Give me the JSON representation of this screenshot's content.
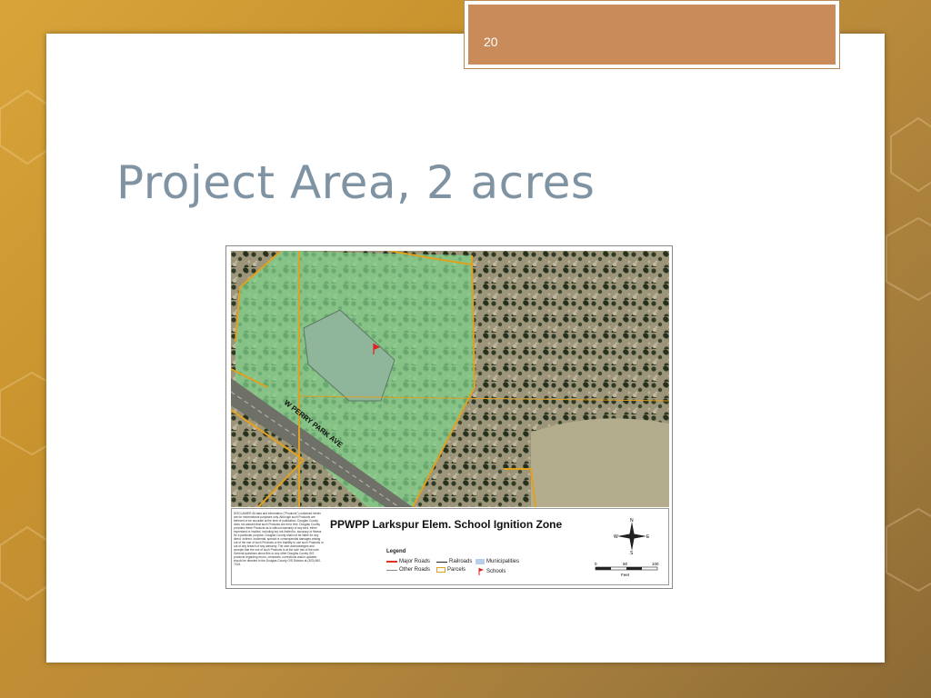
{
  "slide": {
    "number": "20",
    "title": "Project Area, 2 acres"
  },
  "map": {
    "road_label": "W PERRY PARK AVE",
    "title": "PPWPP Larkspur Elem. School Ignition Zone",
    "disclaimer": "DISCLAIMER All data and information (\"Products\") contained herein are for informational purposes only. Although such Products are believed to be accurate at the time of publication, Douglas County does not warrant that such Products are error free. Douglas County provides these Products as is without warranty of any kind, either expressed or implied, including but not limited to, accuracy or fitness for a particular purpose. Douglas County shall not be liable for any direct, indirect, incidental, special or consequential damages arising out of the use of such Products or the inability to use such Products or out of any breach of any warranty. The user acknowledges and accepts that the use of such Products is at the sole risk of the user. General questions about this or any other Douglas County GIS products regarding errors, omissions, corrections and/or updates should be directed to the Douglas County GIS Division at (303) 660-7416.",
    "legend": {
      "heading": "Legend",
      "items": [
        {
          "label": "Major Roads",
          "color": "#e03020"
        },
        {
          "label": "Other Roads",
          "color": "#888888"
        },
        {
          "label": "Railroads",
          "color": "#222222"
        },
        {
          "label": "Parcels",
          "color": "#e0a020"
        },
        {
          "label": "Municipalities",
          "color": "#b8cfe8"
        },
        {
          "label": "Schools",
          "color": "#e02020"
        }
      ]
    },
    "compass": {
      "n": "N",
      "s": "S",
      "e": "E",
      "w": "W"
    },
    "scale": {
      "ticks": [
        "0",
        "50",
        "100"
      ],
      "unit": "Feet"
    },
    "colors": {
      "zone_fill": "#7fd08a",
      "parcel_line": "#e0a020",
      "terrain": "#8a8a6a"
    }
  }
}
